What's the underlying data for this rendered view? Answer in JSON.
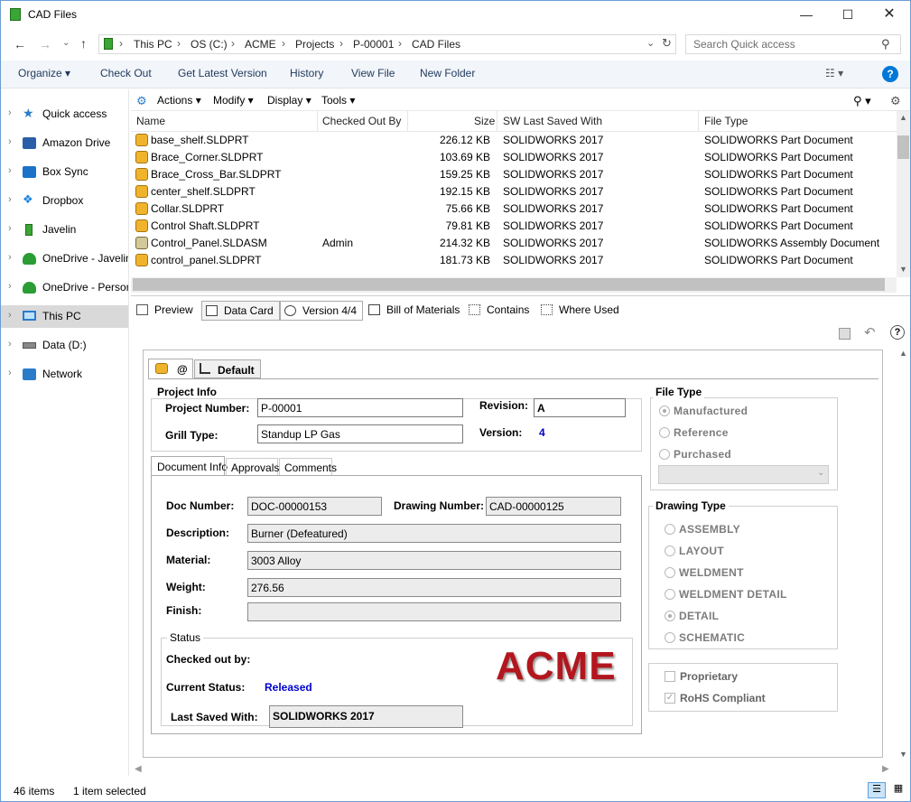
{
  "window": {
    "title": "CAD Files"
  },
  "address": {
    "crumbs": [
      "This PC",
      "OS (C:)",
      "ACME",
      "Projects",
      "P-00001",
      "CAD Files"
    ],
    "search_placeholder": "Search Quick access"
  },
  "command_bar": {
    "organize": "Organize",
    "check_out": "Check Out",
    "get_latest": "Get Latest Version",
    "history": "History",
    "view_file": "View File",
    "new_folder": "New Folder"
  },
  "nav": {
    "items": [
      {
        "label": "Quick access",
        "icon": "star-icon"
      },
      {
        "label": "Amazon Drive",
        "icon": "amazon-drive-icon"
      },
      {
        "label": "Box Sync",
        "icon": "box-icon"
      },
      {
        "label": "Dropbox",
        "icon": "dropbox-icon"
      },
      {
        "label": "Javelin",
        "icon": "javelin-icon"
      },
      {
        "label": "OneDrive - Javelin",
        "icon": "onedrive-icon"
      },
      {
        "label": "OneDrive - Personal",
        "icon": "onedrive-icon"
      },
      {
        "label": "This PC",
        "icon": "pc-icon"
      },
      {
        "label": "Data (D:)",
        "icon": "drive-icon"
      },
      {
        "label": "Network",
        "icon": "network-icon"
      }
    ]
  },
  "pdm_menu": {
    "actions": "Actions",
    "modify": "Modify",
    "display": "Display",
    "tools": "Tools"
  },
  "file_list": {
    "columns": {
      "name": "Name",
      "checked_out_by": "Checked Out By",
      "size": "Size",
      "sw_saved": "SW Last Saved With",
      "file_type": "File Type"
    },
    "rows": [
      {
        "name": "base_shelf.SLDPRT",
        "checked_out_by": "",
        "size": "226.12 KB",
        "sw": "SOLIDWORKS 2017",
        "type": "SOLIDWORKS Part Document"
      },
      {
        "name": "Brace_Corner.SLDPRT",
        "checked_out_by": "",
        "size": "103.69 KB",
        "sw": "SOLIDWORKS 2017",
        "type": "SOLIDWORKS Part Document"
      },
      {
        "name": "Brace_Cross_Bar.SLDPRT",
        "checked_out_by": "",
        "size": "159.25 KB",
        "sw": "SOLIDWORKS 2017",
        "type": "SOLIDWORKS Part Document"
      },
      {
        "name": "center_shelf.SLDPRT",
        "checked_out_by": "",
        "size": "192.15 KB",
        "sw": "SOLIDWORKS 2017",
        "type": "SOLIDWORKS Part Document"
      },
      {
        "name": "Collar.SLDPRT",
        "checked_out_by": "",
        "size": "75.66 KB",
        "sw": "SOLIDWORKS 2017",
        "type": "SOLIDWORKS Part Document"
      },
      {
        "name": "Control Shaft.SLDPRT",
        "checked_out_by": "",
        "size": "79.81 KB",
        "sw": "SOLIDWORKS 2017",
        "type": "SOLIDWORKS Part Document"
      },
      {
        "name": "Control_Panel.SLDASM",
        "checked_out_by": "Admin",
        "size": "214.32 KB",
        "sw": "SOLIDWORKS 2017",
        "type": "SOLIDWORKS Assembly Document"
      },
      {
        "name": "control_panel.SLDPRT",
        "checked_out_by": "",
        "size": "181.73 KB",
        "sw": "SOLIDWORKS 2017",
        "type": "SOLIDWORKS Part Document"
      }
    ]
  },
  "tabs": {
    "preview": "Preview",
    "data_card": "Data Card",
    "version": "Version 4/4",
    "bom": "Bill of Materials",
    "contains": "Contains",
    "where_used": "Where Used"
  },
  "card": {
    "config_tab_at": "@",
    "config_tab_default": "Default",
    "project_info": {
      "legend": "Project Info",
      "project_number_label": "Project Number:",
      "project_number": "P-00001",
      "revision_label": "Revision:",
      "revision": "A",
      "grill_type_label": "Grill Type:",
      "grill_type": "Standup LP Gas",
      "version_label": "Version:",
      "version": "4"
    },
    "subtabs": {
      "doc_info": "Document Info",
      "approvals": "Approvals",
      "comments": "Comments"
    },
    "doc": {
      "doc_number_label": "Doc Number:",
      "doc_number": "DOC-00000153",
      "drawing_number_label": "Drawing Number:",
      "drawing_number": "CAD-00000125",
      "description_label": "Description:",
      "description": "Burner (Defeatured)",
      "material_label": "Material:",
      "material": "3003 Alloy",
      "weight_label": "Weight:",
      "weight": "276.56",
      "finish_label": "Finish:",
      "finish": ""
    },
    "status": {
      "legend": "Status",
      "checked_out_label": "Checked out by:",
      "checked_out": "",
      "current_status_label": "Current Status:",
      "current_status": "Released",
      "last_saved_label": "Last Saved With:",
      "last_saved": "SOLIDWORKS 2017",
      "logo": "ACME"
    },
    "file_type": {
      "legend": "File Type",
      "options": [
        "Manufactured",
        "Reference",
        "Purchased"
      ],
      "selected": "Manufactured"
    },
    "drawing_type": {
      "legend": "Drawing Type",
      "options": [
        "ASSEMBLY",
        "LAYOUT",
        "WELDMENT",
        "WELDMENT DETAIL",
        "DETAIL",
        "SCHEMATIC"
      ],
      "selected": "DETAIL"
    },
    "flags": {
      "proprietary": "Proprietary",
      "proprietary_checked": false,
      "rohs": "RoHS Compliant",
      "rohs_checked": true
    }
  },
  "statusbar": {
    "items": "46 items",
    "selected": "1 item selected"
  },
  "colors": {
    "accent": "#0078d7",
    "status_released": "#0000cc",
    "logo_red": "#b3161e",
    "selection": "#d9d9d9"
  }
}
